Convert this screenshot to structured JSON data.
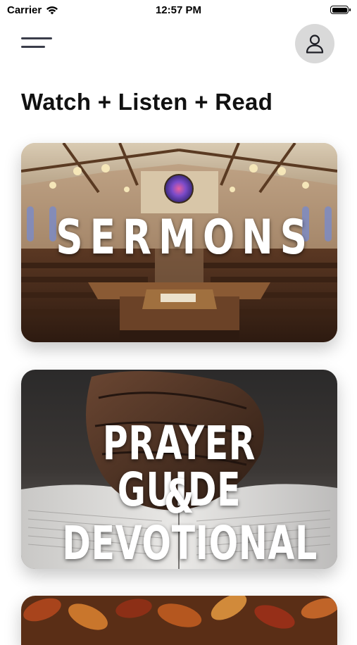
{
  "status_bar": {
    "carrier": "Carrier",
    "time": "12:57 PM"
  },
  "header": {
    "menu_icon": "hamburger-menu-icon",
    "profile_icon": "user-icon"
  },
  "page": {
    "title": "Watch + Listen + Read"
  },
  "cards": [
    {
      "label": "SERMONS",
      "image": "church-sanctuary-pulpit"
    },
    {
      "label_line1": "PRAYER GUIDE",
      "label_line2": "& DEVOTIONAL",
      "image": "praying-hands-bible"
    },
    {
      "label": "",
      "image": "autumn-leaves"
    }
  ],
  "colors": {
    "accent": "#3a3d4a",
    "profile_bg": "#d9d9d9"
  }
}
